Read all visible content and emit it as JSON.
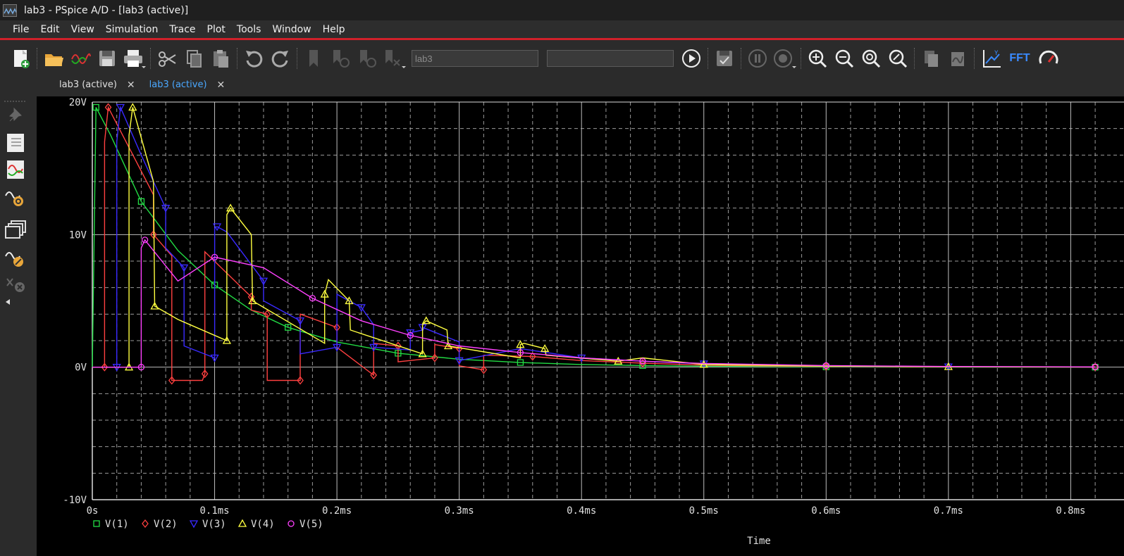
{
  "window": {
    "title": "lab3 - PSpice A/D  - [lab3 (active)]"
  },
  "menu": [
    "File",
    "Edit",
    "View",
    "Simulation",
    "Trace",
    "Plot",
    "Tools",
    "Window",
    "Help"
  ],
  "toolbar": {
    "profile_value": "lab3",
    "run_status_value": "",
    "fft_label": "FFT",
    "icons": [
      "new-file-icon",
      "open-folder-icon",
      "waveform-icon",
      "save-icon",
      "print-icon",
      "cut-icon",
      "copy-icon",
      "paste-icon",
      "undo-icon",
      "redo-icon",
      "bookmark-icon",
      "mark-data-icon",
      "mark-prev-icon",
      "delete-mark-icon",
      "run-icon",
      "save-sim-icon",
      "pause-icon",
      "stop-icon",
      "zoom-in-icon",
      "zoom-out-icon",
      "zoom-fit-icon",
      "zoom-area-icon",
      "copy-plot-icon",
      "add-plot-icon",
      "axis-settings-icon",
      "fft-icon",
      "performance-icon"
    ]
  },
  "tabs": [
    {
      "label": "lab3 (active)",
      "active": false
    },
    {
      "label": "lab3 (active)",
      "active": true
    }
  ],
  "colors": {
    "background": "#000000",
    "grid_major": "#bdbdbd",
    "grid_minor": "#9a9a9a",
    "tab_active": "#4aa8ff",
    "menu_underline": "#d0202a"
  },
  "chart_data": {
    "type": "line",
    "xlabel": "Time",
    "ylabel": "",
    "xlim": [
      0,
      0.82
    ],
    "ylim": [
      -10,
      20
    ],
    "x_unit": "ms",
    "x_ticks": [
      {
        "value": 0,
        "label": "0s"
      },
      {
        "value": 0.1,
        "label": "0.1ms"
      },
      {
        "value": 0.2,
        "label": "0.2ms"
      },
      {
        "value": 0.3,
        "label": "0.3ms"
      },
      {
        "value": 0.4,
        "label": "0.4ms"
      },
      {
        "value": 0.5,
        "label": "0.5ms"
      },
      {
        "value": 0.6,
        "label": "0.6ms"
      },
      {
        "value": 0.7,
        "label": "0.7ms"
      },
      {
        "value": 0.8,
        "label": "0.8ms"
      }
    ],
    "y_ticks": [
      {
        "value": 20,
        "label": "20V"
      },
      {
        "value": 10,
        "label": "10V"
      },
      {
        "value": 0,
        "label": "0V"
      },
      {
        "value": -10,
        "label": "-10V"
      }
    ],
    "grid": true,
    "legend_position": "bottom-left",
    "series": [
      {
        "name": "V(1)",
        "color": "#22dd44",
        "marker": "square",
        "x": [
          0,
          0.003,
          0.015,
          0.04,
          0.07,
          0.1,
          0.13,
          0.16,
          0.2,
          0.25,
          0.3,
          0.35,
          0.4,
          0.45,
          0.5,
          0.6,
          0.7,
          0.82
        ],
        "y": [
          0,
          19.6,
          17.5,
          12.5,
          8.8,
          6.2,
          4.3,
          3.0,
          1.9,
          1.05,
          0.6,
          0.35,
          0.2,
          0.12,
          0.07,
          0.02,
          0.01,
          0
        ]
      },
      {
        "name": "V(2)",
        "color": "#ff4040",
        "marker": "diamond",
        "x": [
          0,
          0.01,
          0.01,
          0.013,
          0.05,
          0.05,
          0.065,
          0.065,
          0.09,
          0.092,
          0.092,
          0.13,
          0.13,
          0.143,
          0.143,
          0.17,
          0.17,
          0.2,
          0.2,
          0.23,
          0.23,
          0.25,
          0.25,
          0.28,
          0.28,
          0.3,
          0.3,
          0.32,
          0.32,
          0.36,
          0.4,
          0.45,
          0.5,
          0.6,
          0.7,
          0.82
        ],
        "y": [
          0,
          0,
          17,
          19.6,
          13,
          10,
          8.4,
          -1,
          -1,
          -0.5,
          8.7,
          5.3,
          4.3,
          4.0,
          -1,
          -1,
          4.0,
          3.0,
          1.5,
          -0.6,
          1.8,
          1.6,
          0.4,
          0.7,
          1.7,
          1.4,
          0.1,
          -0.2,
          0.9,
          0.8,
          0.5,
          0.3,
          0.15,
          0.05,
          0.02,
          0.01
        ]
      },
      {
        "name": "V(3)",
        "color": "#3a2aff",
        "marker": "triangle-down",
        "x": [
          0,
          0.02,
          0.02,
          0.023,
          0.04,
          0.06,
          0.06,
          0.075,
          0.075,
          0.1,
          0.1,
          0.102,
          0.11,
          0.14,
          0.14,
          0.17,
          0.17,
          0.2,
          0.2,
          0.22,
          0.23,
          0.23,
          0.26,
          0.26,
          0.27,
          0.27,
          0.3,
          0.3,
          0.35,
          0.4,
          0.45,
          0.5,
          0.6,
          0.7,
          0.82
        ],
        "y": [
          0,
          0,
          17,
          19.6,
          16,
          12,
          9,
          7.5,
          1.6,
          0.7,
          10.5,
          10.6,
          10.2,
          6.5,
          5,
          3.5,
          1.0,
          1.5,
          5.5,
          4.5,
          3.2,
          1.5,
          1.3,
          2.6,
          2.8,
          3.0,
          1.9,
          0.5,
          1.4,
          0.7,
          0.45,
          0.25,
          0.07,
          0.03,
          0.01
        ]
      },
      {
        "name": "V(4)",
        "color": "#ffff40",
        "marker": "triangle",
        "x": [
          0,
          0.03,
          0.03,
          0.033,
          0.05,
          0.051,
          0.07,
          0.11,
          0.11,
          0.113,
          0.13,
          0.131,
          0.19,
          0.19,
          0.193,
          0.21,
          0.211,
          0.27,
          0.27,
          0.273,
          0.29,
          0.291,
          0.35,
          0.35,
          0.353,
          0.37,
          0.371,
          0.43,
          0.45,
          0.5,
          0.6,
          0.7,
          0.82
        ],
        "y": [
          0,
          0,
          17.5,
          19.6,
          14,
          4.6,
          3.6,
          2.0,
          11.5,
          12.0,
          10.0,
          5.0,
          1.8,
          5.5,
          6.6,
          5.0,
          2.8,
          1.0,
          3.2,
          3.5,
          2.8,
          1.6,
          0.7,
          1.7,
          1.8,
          1.4,
          0.9,
          0.45,
          0.7,
          0.2,
          0.08,
          0.03,
          0.01
        ]
      },
      {
        "name": "V(5)",
        "color": "#ff40ff",
        "marker": "circle",
        "x": [
          0,
          0.04,
          0.04,
          0.043,
          0.07,
          0.1,
          0.14,
          0.18,
          0.22,
          0.26,
          0.3,
          0.35,
          0.4,
          0.45,
          0.5,
          0.6,
          0.7,
          0.82
        ],
        "y": [
          0,
          0,
          9,
          9.6,
          6.5,
          8.3,
          7.5,
          5.2,
          3.5,
          2.4,
          1.6,
          1.1,
          0.7,
          0.45,
          0.28,
          0.12,
          0.05,
          0.02
        ]
      }
    ]
  }
}
